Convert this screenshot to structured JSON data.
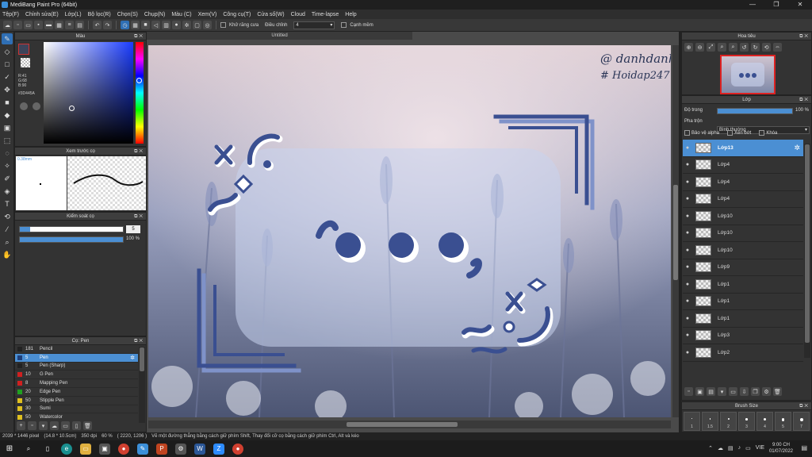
{
  "window": {
    "title": "MediBang Paint Pro (64bit)",
    "minimize": "—",
    "maximize": "❐",
    "close": "✕"
  },
  "menu": [
    "Tệp(F)",
    "Chỉnh sửa(E)",
    "Lớp(L)",
    "Bộ lọc(R)",
    "Chọn(S)",
    "Chụp(N)",
    "Màu (C)",
    "Xem(V)",
    "Công cụ(T)",
    "Cửa số(W)",
    "Cloud",
    "Time-lapse",
    "Help"
  ],
  "toolbar": {
    "antialias_label": "Khử răng cưa",
    "adjust_label": "Điều chỉnh",
    "adjust_value": "4",
    "canh_mem_label": "Cạnh mềm"
  },
  "document": {
    "tab": "Untitled"
  },
  "color_panel": {
    "title": "Màu",
    "r": "R:41",
    "g": "G:68",
    "b": "B:90",
    "hex": "#3D445A",
    "fg_color": "#3d445a",
    "bg_color": "#ffffff"
  },
  "brush_preview": {
    "title": "Xem trước cọ",
    "size": "0.38mm"
  },
  "brush_control": {
    "title": "Kiểm soát cọ",
    "size_value": "5",
    "size_fraction": 0.1,
    "opacity_value": "100 %",
    "opacity_fraction": 1.0
  },
  "brush_list": {
    "title": "Cọ: Pen",
    "items": [
      {
        "size": "181",
        "name": "Pencil",
        "color": "#222"
      },
      {
        "size": "5",
        "name": "Pen",
        "color": "#1f3f7a",
        "selected": true
      },
      {
        "size": "5",
        "name": "Pen (Sharp)",
        "color": "#222"
      },
      {
        "size": "10",
        "name": "G Pen",
        "color": "#d02020"
      },
      {
        "size": "8",
        "name": "Mapping Pen",
        "color": "#d02020"
      },
      {
        "size": "20",
        "name": "Edge Pen",
        "color": "#20a020"
      },
      {
        "size": "50",
        "name": "Stipple Pen",
        "color": "#e0c020"
      },
      {
        "size": "30",
        "name": "Sumi",
        "color": "#e0c020"
      },
      {
        "size": "50",
        "name": "Watercolor",
        "color": "#e0c020"
      }
    ]
  },
  "navigator": {
    "title": "Hoa tiêu"
  },
  "layer_panel": {
    "title": "Lớp",
    "opacity_label": "Độ trong",
    "opacity_value": "100 %",
    "opacity_fraction": 1.0,
    "blend_label": "Pha trộn",
    "blend_value": "Bình thường",
    "protect_alpha": "Bảo vệ alpha",
    "clipping": "Xén bớt",
    "lock": "Khóa",
    "layers": [
      "Lớp13",
      "Lớp4",
      "Lớp4",
      "Lớp4",
      "Lớp10",
      "Lớp10",
      "Lớp10",
      "Lớp9",
      "Lớp1",
      "Lớp1",
      "Lớp1",
      "Lớp3",
      "Lớp2"
    ],
    "selected_index": 0
  },
  "brush_size_panel": {
    "title": "Brush Size",
    "sizes": [
      "1",
      "1.5",
      "2",
      "3",
      "4",
      "5",
      "7"
    ]
  },
  "artwork": {
    "watermark_line1": "@ danhdanh",
    "watermark_line2": "# Hoidap247"
  },
  "status": {
    "size_px": "2039 * 1446 pixel",
    "size_cm": "(14.8 * 10.5cm)",
    "dpi": "350 dpi",
    "zoom": "60 %",
    "coords": "( 2220, 1206 )",
    "hint": "Vẽ một đường thẳng bằng cách giữ phím Shift, Thay đổi cỡ cọ bằng cách giữ phím Ctrl, Alt và kéo"
  },
  "taskbar": {
    "time": "9:00 CH",
    "date": "01/07/2022",
    "lang": "VIE"
  },
  "colors": {
    "accent": "#4b8fd3",
    "shape_dark": "#3a4f91",
    "shape_shadow": "#7f92c9",
    "shape_light": "#ffffff"
  }
}
